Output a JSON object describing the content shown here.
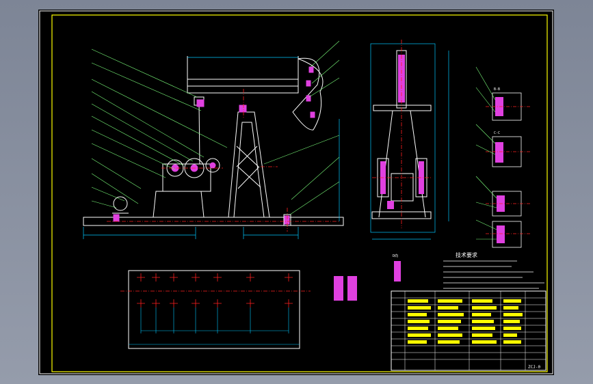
{
  "colors": {
    "background": "#000000",
    "outer_frame": "#ffffff",
    "inner_frame": "#ffff00",
    "outline": "#ffffff",
    "dimension": "#00c8ff",
    "leader": "#7cff7c",
    "center_line": "#ff2020",
    "part": "#e040e0",
    "note_text": "#ffffff",
    "title_text": "#ffff00"
  },
  "notes": {
    "heading": "技术要求"
  },
  "detail_views": {
    "view_bb": "B-B",
    "view_cc": "C-C",
    "view_d": "D向"
  },
  "title_block": {
    "drawing_number": "ZCJ-0"
  }
}
